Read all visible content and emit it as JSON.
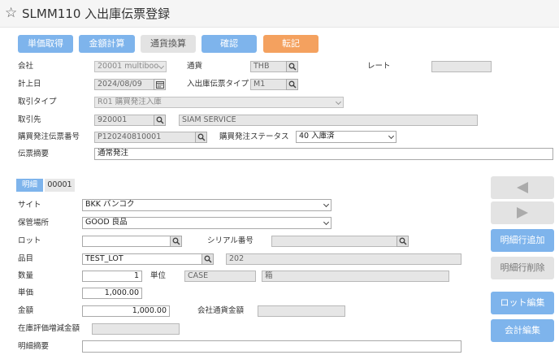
{
  "window": {
    "title": "SLMM110 入出庫伝票登録"
  },
  "toolbar": {
    "unit_price": "単価取得",
    "amount_calc": "金額計算",
    "currency_conv": "通貨換算",
    "confirm": "確認",
    "post": "転記"
  },
  "header": {
    "company_label": "会社",
    "company_value": "20001 multiboo",
    "currency_label": "通貨",
    "currency_value": "THB",
    "rate_label": "レート",
    "rate_value": "",
    "posting_date_label": "計上日",
    "posting_date_value": "2024/08/09",
    "slip_type_label": "入出庫伝票タイプ",
    "slip_type_value": "M1",
    "trans_type_label": "取引タイプ",
    "trans_type_value": "R01 購買発注入庫",
    "partner_label": "取引先",
    "partner_code": "920001",
    "partner_name": "SIAM SERVICE",
    "po_no_label": "購買発注伝票番号",
    "po_no_value": "P120240810001",
    "po_status_label": "購買発注ステータス",
    "po_status_value": "40 入庫済",
    "memo_label": "伝票摘要",
    "memo_value": "通常発注"
  },
  "detail_tab": {
    "label": "明細",
    "line_no": "00001"
  },
  "detail": {
    "site_label": "サイト",
    "site_value": "BKK バンコク",
    "storage_label": "保管場所",
    "storage_value": "GOOD 良品",
    "lot_label": "ロット",
    "lot_value": "",
    "serial_label": "シリアル番号",
    "serial_value": "",
    "item_label": "品目",
    "item_code": "TEST_LOT",
    "item_name": "202",
    "qty_label": "数量",
    "qty_value": "1",
    "unit_label": "単位",
    "unit_code": "CASE",
    "unit_name": "箱",
    "price_label": "単価",
    "price_value": "1,000.00",
    "amount_label": "金額",
    "amount_value": "1,000.00",
    "company_amount_label": "会社通貨金額",
    "company_amount_value": "",
    "inv_diff_label": "在庫評価増減金額",
    "inv_diff_value": "",
    "line_memo_label": "明細摘要",
    "line_memo_value": ""
  },
  "side": {
    "add_line": "明細行追加",
    "delete_line": "明細行削除",
    "lot_edit": "ロット編集",
    "acct_edit": "会計編集"
  },
  "colors": {
    "accent": "#7eb4ec",
    "post": "#f4a15f",
    "disabled": "#e3e3e3"
  }
}
